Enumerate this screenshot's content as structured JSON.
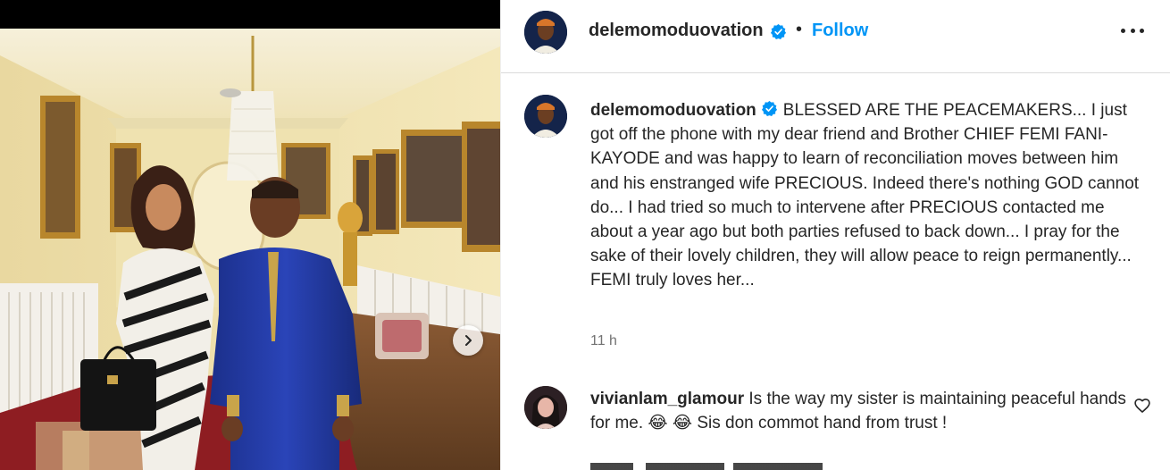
{
  "post": {
    "username": "delemomoduovation",
    "follow_label": "Follow",
    "separator": "•",
    "time": "11 h"
  },
  "caption": {
    "username": "delemomoduovation",
    "text": "BLESSED ARE THE PEACEMAKERS... I just got off the phone with my dear friend and Brother CHIEF FEMI FANI-KAYODE and was happy to learn of reconciliation moves between him and his enstranged wife PRECIOUS. Indeed there's nothing GOD cannot do... I had tried so much to intervene after PRECIOUS contacted me about a year ago but both parties refused to back down... I pray for the sake of their lovely children, they will allow peace to reign permanently... FEMI truly loves her..."
  },
  "comments": [
    {
      "username": "vivianlam_glamour",
      "text": "Is the way my sister is maintaining peaceful hands for me. 😂 😂 Sis don commot hand from trust !"
    }
  ],
  "icons": {
    "verified": "verified-badge-icon",
    "more": "more-options-icon",
    "next": "chevron-right-icon",
    "like": "heart-icon"
  },
  "colors": {
    "accent": "#0095f6",
    "text": "#262626",
    "muted": "#737373",
    "divider": "#dbdbdb"
  }
}
